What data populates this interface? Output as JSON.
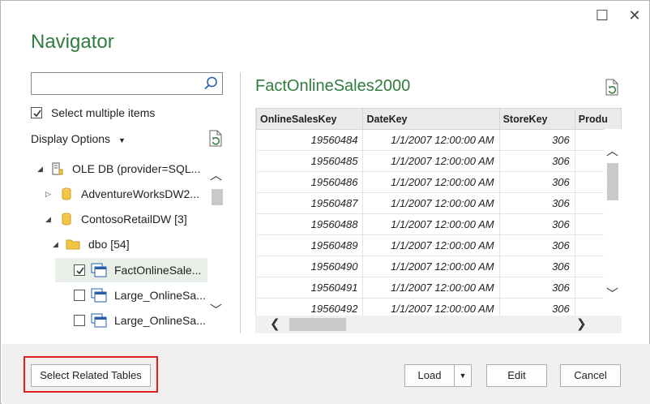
{
  "window": {
    "title": "Navigator",
    "maximize_glyph": "☐",
    "close_glyph": "✕"
  },
  "left": {
    "search": {
      "value": "",
      "placeholder": ""
    },
    "select_multiple": {
      "label": "Select multiple items",
      "checked": true
    },
    "display_options": "Display Options",
    "tree": [
      {
        "label": "OLE DB (provider=SQL...",
        "icon": "server-icon",
        "expanded": true
      },
      {
        "label": "AdventureWorksDW2...",
        "icon": "database-icon",
        "expanded": false
      },
      {
        "label": "ContosoRetailDW [3]",
        "icon": "database-icon",
        "expanded": true
      },
      {
        "label": "dbo [54]",
        "icon": "folder-icon",
        "expanded": true
      },
      {
        "label": "FactOnlineSale...",
        "icon": "table-icon",
        "checked": true,
        "selected": true
      },
      {
        "label": "Large_OnlineSa...",
        "icon": "table-icon",
        "checked": false
      },
      {
        "label": "Large_OnlineSa...",
        "icon": "table-icon",
        "checked": false
      }
    ]
  },
  "preview": {
    "title": "FactOnlineSales2000",
    "columns": [
      "OnlineSalesKey",
      "DateKey",
      "StoreKey",
      "Produ"
    ],
    "rows": [
      [
        "19560484",
        "1/1/2007 12:00:00 AM",
        "306",
        ""
      ],
      [
        "19560485",
        "1/1/2007 12:00:00 AM",
        "306",
        ""
      ],
      [
        "19560486",
        "1/1/2007 12:00:00 AM",
        "306",
        ""
      ],
      [
        "19560487",
        "1/1/2007 12:00:00 AM",
        "306",
        ""
      ],
      [
        "19560488",
        "1/1/2007 12:00:00 AM",
        "306",
        ""
      ],
      [
        "19560489",
        "1/1/2007 12:00:00 AM",
        "306",
        ""
      ],
      [
        "19560490",
        "1/1/2007 12:00:00 AM",
        "306",
        ""
      ],
      [
        "19560491",
        "1/1/2007 12:00:00 AM",
        "306",
        ""
      ],
      [
        "19560492",
        "1/1/2007 12:00:00 AM",
        "306",
        ""
      ]
    ]
  },
  "footer": {
    "select_related": "Select Related Tables",
    "load": "Load",
    "edit": "Edit",
    "cancel": "Cancel"
  },
  "colors": {
    "accent_green": "#2f7d3d",
    "highlight_red": "#e02020",
    "selection_bg": "#e7efe8"
  }
}
